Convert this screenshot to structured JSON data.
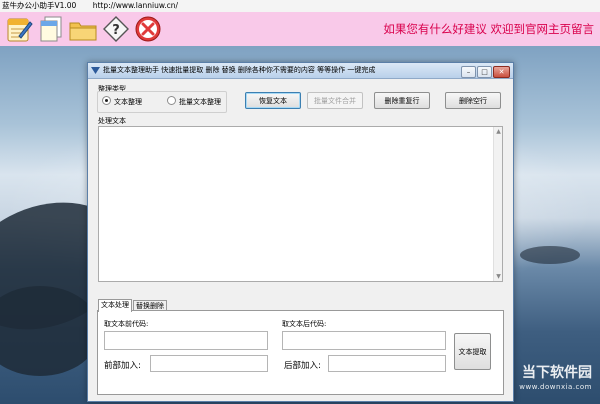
{
  "app": {
    "title": "蓝牛办公小助手V1.00",
    "url": "http://www.lanniuw.cn/"
  },
  "toolbar": {
    "message": "如果您有什么好建议 欢迎到官网主页留言",
    "buttons": [
      {
        "icon": "edit-notepad-icon"
      },
      {
        "icon": "documents-icon"
      },
      {
        "icon": "folder-icon"
      },
      {
        "icon": "help-icon"
      },
      {
        "icon": "close-icon"
      }
    ]
  },
  "dialog": {
    "title": "批量文本整理助手   快速批量提取 删除 替换 删除各种你不需要的内容 等等操作 一键完成",
    "controls": {
      "minimize": "–",
      "maximize": "□",
      "close": "✕"
    },
    "mode_group_label": "整理类型",
    "mode_options": [
      {
        "label": "文本整理",
        "selected": true
      },
      {
        "label": "批量文本整理",
        "selected": false
      }
    ],
    "buttons": {
      "restore": "恢复文本",
      "batch_merge": "批量文件合并",
      "remove_duplicates": "删除重复行",
      "remove_blank": "删除空行"
    },
    "textarea_label": "处理文本",
    "textarea_value": "",
    "tabs": [
      {
        "label": "文本处理",
        "active": true
      },
      {
        "label": "替换删除",
        "active": false
      }
    ],
    "extract": {
      "before_label": "取文本前代码:",
      "after_label": "取文本后代码:",
      "prefix_label": "前部加入:",
      "suffix_label": "后部加入:",
      "extract_button": "文本提取"
    }
  },
  "watermark": {
    "title": "当下软件园",
    "sub": "www.downxia.com"
  }
}
